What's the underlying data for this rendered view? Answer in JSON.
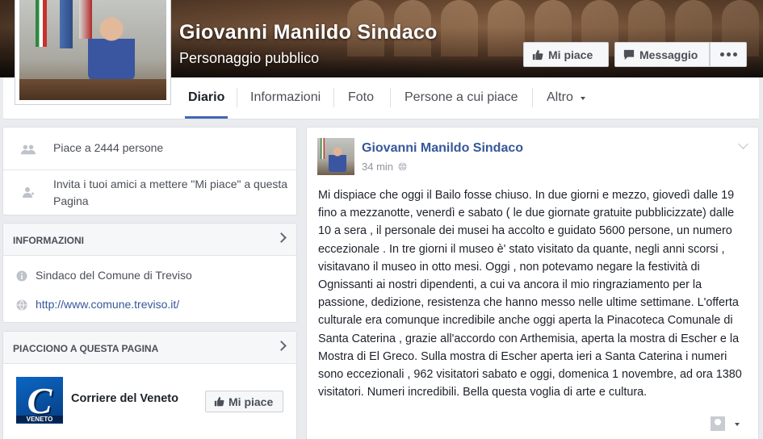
{
  "header": {
    "title": "Giovanni Manildo Sindaco",
    "category": "Personaggio pubblico",
    "like_button": "Mi piace",
    "message_button": "Messaggio"
  },
  "tabs": [
    {
      "label": "Diario",
      "active": true
    },
    {
      "label": "Informazioni",
      "active": false
    },
    {
      "label": "Foto",
      "active": false
    },
    {
      "label": "Persone a cui piace",
      "active": false
    },
    {
      "label": "Altro",
      "active": false
    }
  ],
  "likes_card": {
    "likes_text": "Piace a 2444 persone",
    "invite_text": "Invita i tuoi amici a mettere \"Mi piace\" a questa Pagina"
  },
  "info_card": {
    "title": "INFORMAZIONI",
    "description": "Sindaco del Comune di Treviso",
    "website": "http://www.comune.treviso.it/"
  },
  "liked_pages_card": {
    "title": "PIACCIONO A QUESTA PAGINA",
    "pages": [
      {
        "name": "Corriere del Veneto",
        "logo_letter": "C",
        "logo_sub": "VENETO",
        "button": "Mi piace"
      }
    ]
  },
  "post": {
    "author": "Giovanni Manildo Sindaco",
    "time": "34 min",
    "body": "Mi dispiace che oggi il Bailo fosse chiuso. In due giorni e mezzo, giovedì dalle 19 fino a mezzanotte, venerdì e sabato ( le due giornate gratuite pubblicizzate) dalle 10 a sera , il personale dei musei ha accolto e guidato 5600 persone, un numero eccezionale . In tre giorni il museo è' stato visitato da quante, negli anni scorsi , visitavano il museo in otto mesi. Oggi , non potevamo negare la festività di Ognissanti ai nostri dipendenti, a cui va ancora il mio ringraziamento per la passione, dedizione, resistenza che hanno messo nelle ultime settimane. L'offerta culturale era comunque incredibile anche oggi aperta la Pinacoteca Comunale di Santa Caterina , grazie all'accordo con Arthemisia, aperta la mostra di Escher e la Mostra di El Greco. Sulla mostra di Escher aperta ieri a Santa Caterina i numeri sono eccezionali , 962 visitatori sabato e oggi, domenica 1 novembre, ad ora 1380 visitatori. Numeri incredibili. Bella questa voglia di arte e cultura."
  },
  "icons": {
    "like": "thumbs-up-icon",
    "message": "speech-bubble-icon",
    "more": "ellipsis-icon",
    "people": "people-icon",
    "invite": "add-person-icon",
    "info": "info-icon",
    "globe": "globe-icon",
    "privacy": "globe-privacy-icon"
  },
  "colors": {
    "link": "#365899",
    "accent": "#4267b2",
    "background": "#e9ebee"
  }
}
